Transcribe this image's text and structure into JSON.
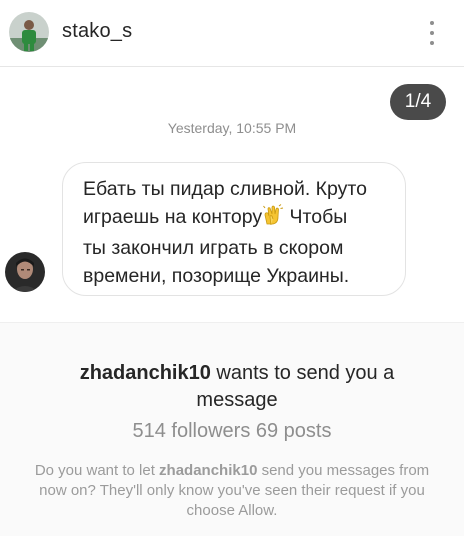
{
  "header": {
    "username": "stako_s",
    "more_icon": "more-vertical-icon"
  },
  "thread": {
    "counter": "1/4",
    "timestamp": "Yesterday, 10:55 PM",
    "message": {
      "line1": "Ебать ты пидар сливной. Круто",
      "line2_before": "играешь на контору",
      "line2_emoji": "clapping-hands-icon",
      "line2_after": " Чтобы",
      "line3": "ты закончил играть в скором",
      "line4": "времени, позорище Украины."
    }
  },
  "request": {
    "sender": "zhadanchik10",
    "title_rest": " wants to send you a message",
    "stats": "514 followers 69 posts",
    "note_before": "Do you want to let ",
    "note_sender": "zhadanchik10",
    "note_after": " send you messages from now on? They'll only know you've seen their request if you choose Allow."
  },
  "colors": {
    "counter_bg": "#4a4a4a",
    "request_bg": "#fafafa",
    "muted_text": "#8e8e8e",
    "avatar_green": "#2e8b3e"
  }
}
